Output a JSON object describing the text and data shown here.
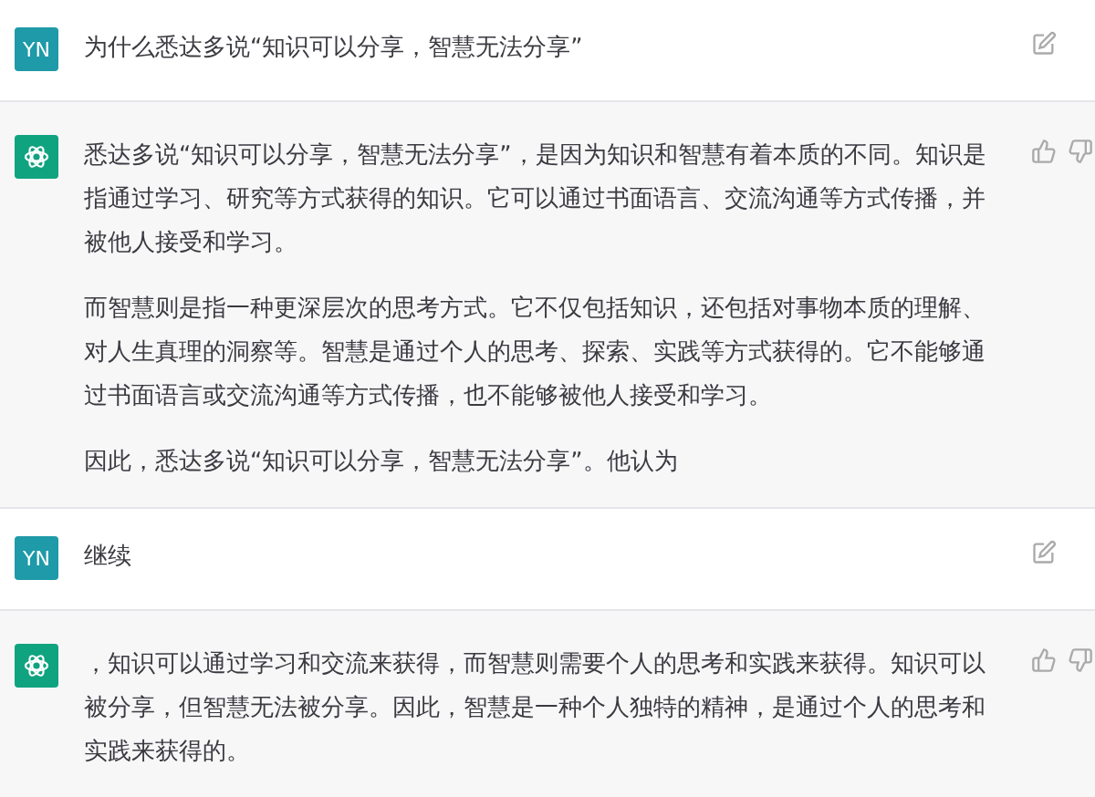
{
  "messages": [
    {
      "kind": "user",
      "avatar": "YN",
      "paragraphs": [
        "为什么悉达多说“知识可以分享，智慧无法分享”"
      ]
    },
    {
      "kind": "assistant",
      "paragraphs": [
        "悉达多说“知识可以分享，智慧无法分享”，是因为知识和智慧有着本质的不同。知识是指通过学习、研究等方式获得的知识。它可以通过书面语言、交流沟通等方式传播，并被他人接受和学习。",
        "而智慧则是指一种更深层次的思考方式。它不仅包括知识，还包括对事物本质的理解、对人生真理的洞察等。智慧是通过个人的思考、探索、实践等方式获得的。它不能够通过书面语言或交流沟通等方式传播，也不能够被他人接受和学习。",
        "因此，悉达多说“知识可以分享，智慧无法分享”。他认为"
      ]
    },
    {
      "kind": "user",
      "avatar": "YN",
      "paragraphs": [
        "继续"
      ]
    },
    {
      "kind": "assistant",
      "paragraphs": [
        "，知识可以通过学习和交流来获得，而智慧则需要个人的思考和实践来获得。知识可以被分享，但智慧无法被分享。因此，智慧是一种个人独特的精神，是通过个人的思考和实践来获得的。"
      ]
    }
  ]
}
